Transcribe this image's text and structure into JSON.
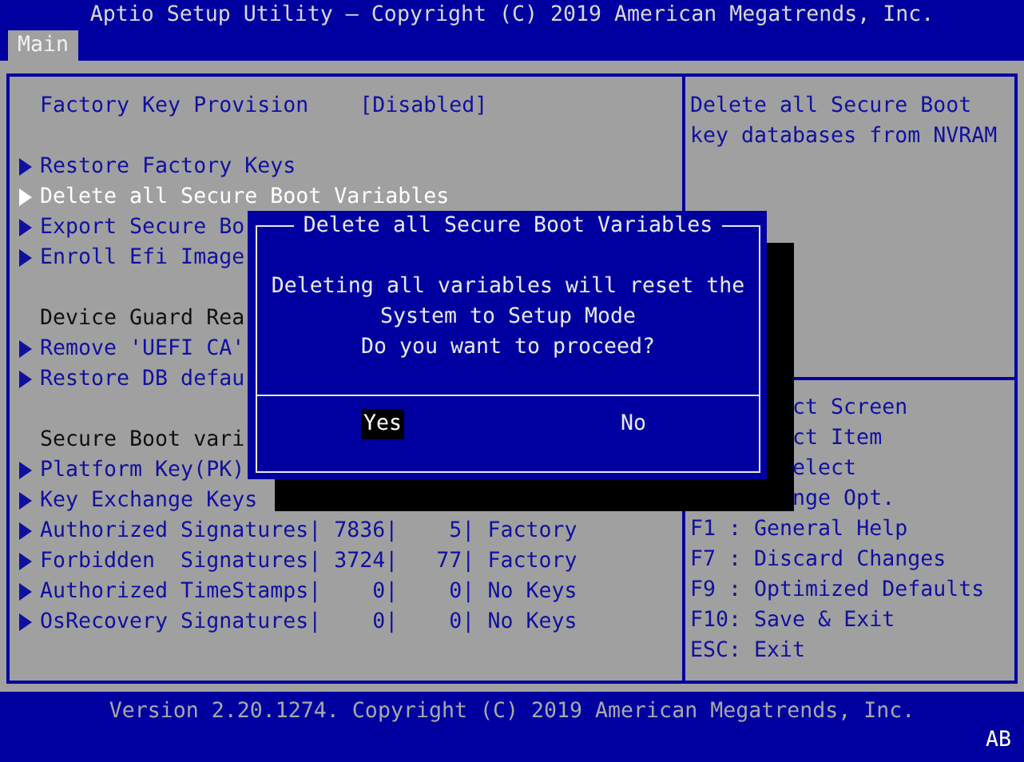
{
  "title_bar": {
    "title": "Aptio Setup Utility – Copyright (C) 2019 American Megatrends, Inc."
  },
  "tabs": [
    {
      "label": "Main",
      "selected": true
    }
  ],
  "items": [
    {
      "kind": "setting",
      "label": "Factory Key Provision",
      "value": "[Disabled]",
      "selected": false
    },
    {
      "kind": "gap"
    },
    {
      "kind": "submenu",
      "label": "Restore Factory Keys",
      "selected": false
    },
    {
      "kind": "submenu",
      "label": "Delete all Secure Boot Variables",
      "selected": true
    },
    {
      "kind": "submenu",
      "label": "Export Secure Bo",
      "selected": false
    },
    {
      "kind": "submenu",
      "label": "Enroll Efi Image",
      "selected": false
    },
    {
      "kind": "gap"
    },
    {
      "kind": "label",
      "label": "Device Guard Rea",
      "selected": false
    },
    {
      "kind": "submenu",
      "label": "Remove 'UEFI CA'",
      "selected": false
    },
    {
      "kind": "submenu",
      "label": "Restore DB defau",
      "selected": false
    },
    {
      "kind": "gap"
    },
    {
      "kind": "label",
      "label": "Secure Boot vari",
      "selected": false
    },
    {
      "kind": "submenu",
      "label": "Platform Key(PK)",
      "selected": false
    },
    {
      "kind": "submenu",
      "label": "Key Exchange Keys",
      "selected": false
    },
    {
      "kind": "submenu",
      "label": "Authorized Signatures| 7836|    5| Factory",
      "selected": false
    },
    {
      "kind": "submenu",
      "label": "Forbidden  Signatures| 3724|   77| Factory",
      "selected": false
    },
    {
      "kind": "submenu",
      "label": "Authorized TimeStamps|    0|    0| No Keys",
      "selected": false
    },
    {
      "kind": "submenu",
      "label": "OsRecovery Signatures|    0|    0| No Keys",
      "selected": false
    }
  ],
  "help": {
    "lines": [
      "Delete all Secure Boot",
      "key databases from NVRAM"
    ]
  },
  "keys": [
    {
      "text": "ct Screen",
      "covered": true
    },
    {
      "text": "ct Item",
      "covered": true
    },
    {
      "text": "elect",
      "covered": true
    },
    {
      "text": "nge Opt.",
      "covered": true
    },
    {
      "text": "F1 : General Help",
      "covered": false
    },
    {
      "text": "F7 : Discard Changes",
      "covered": false
    },
    {
      "text": "F9 : Optimized Defaults",
      "covered": false
    },
    {
      "text": "F10: Save & Exit",
      "covered": false
    },
    {
      "text": "ESC: Exit",
      "covered": false
    }
  ],
  "dialog": {
    "title": "Delete all Secure Boot Variables",
    "message": [
      "Deleting all variables will reset the",
      "System to Setup Mode",
      "Do you want to proceed?"
    ],
    "buttons": [
      {
        "label": "Yes",
        "selected": true
      },
      {
        "label": "No",
        "selected": false
      }
    ]
  },
  "footer": {
    "version": "Version 2.20.1274. Copyright (C) 2019 American Megatrends, Inc.",
    "mode": "AB"
  }
}
